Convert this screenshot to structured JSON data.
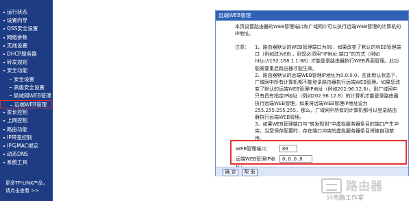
{
  "sidebar": {
    "items": [
      {
        "label": "运行状态"
      },
      {
        "label": "设置向导"
      },
      {
        "label": "QSS安全设置"
      },
      {
        "label": "网络参数"
      },
      {
        "label": "无线设置"
      },
      {
        "label": "DHCP服务器"
      },
      {
        "label": "转发规则"
      },
      {
        "label": "安全功能"
      },
      {
        "label": "安全设置"
      },
      {
        "label": "高级安全设置"
      },
      {
        "label": "局域网WEB管理"
      },
      {
        "label": "远端WEB管理"
      },
      {
        "label": "家长控制"
      },
      {
        "label": "上网控制"
      },
      {
        "label": "路由功能"
      },
      {
        "label": "IP带宽控制"
      },
      {
        "label": "IP与MAC绑定"
      },
      {
        "label": "动态DNS"
      },
      {
        "label": "系统工具"
      }
    ],
    "footer_line1": "更多TP-LINK产品，",
    "footer_line2": "请点击查看 >>"
  },
  "panel": {
    "title": "远端WEB管理",
    "intro": "本页设置路由器的WEB管理端口和广域网中可以执行远端WEB管理的计算机的IP地址。",
    "note_label": "注意：",
    "notes": [
      "1、路由器默认的WEB管理端口为80，如果改变了默认的WEB管理端口（例如改为88），则您必须用“IP地址:端口”的方式（例如http://192.168.1.1:88）才能登录路由器执行WEB界面管理。此功能需要重启路由器才能生效。",
      "2、路由器默认的远端WEB管理IP地址为0.0.0.0，在此默认状态下，广域网中所有计算机都不能登录路由器执行远端WEB管理。如果您改变了默认的远端WEB管理IP地址（例如202.96.12.8），则广域网中只有具有指定IP地址（例如202.96.12.8）的计算机才能登录路由器执行远端WEB管理。如果将远端WEB管理IP地址设为255.255.255.255，那么，广域网中所有的计算机都可以登录路由器执行远端WEB管理。",
      "3、如果WEB管理端口与“转发规则”中虚拟服务器条目的端口产生冲突，当您保存配置时，存在端口冲突的虚拟服务器条目将被自动禁用。"
    ],
    "port_label": "WEB管理端口：",
    "port_value": "80",
    "ip_label": "远端WEB管理IP地址：",
    "ip_value": "0.0.0.0",
    "ok_label": "确 定",
    "help_label": "帮 助"
  },
  "watermark": {
    "brand": "路由器",
    "sub": "兴电脑工作室"
  },
  "colors": {
    "sidebar_bg": "#1d3c83",
    "title_bar": "#2f62b7",
    "highlight": "#e53030"
  }
}
